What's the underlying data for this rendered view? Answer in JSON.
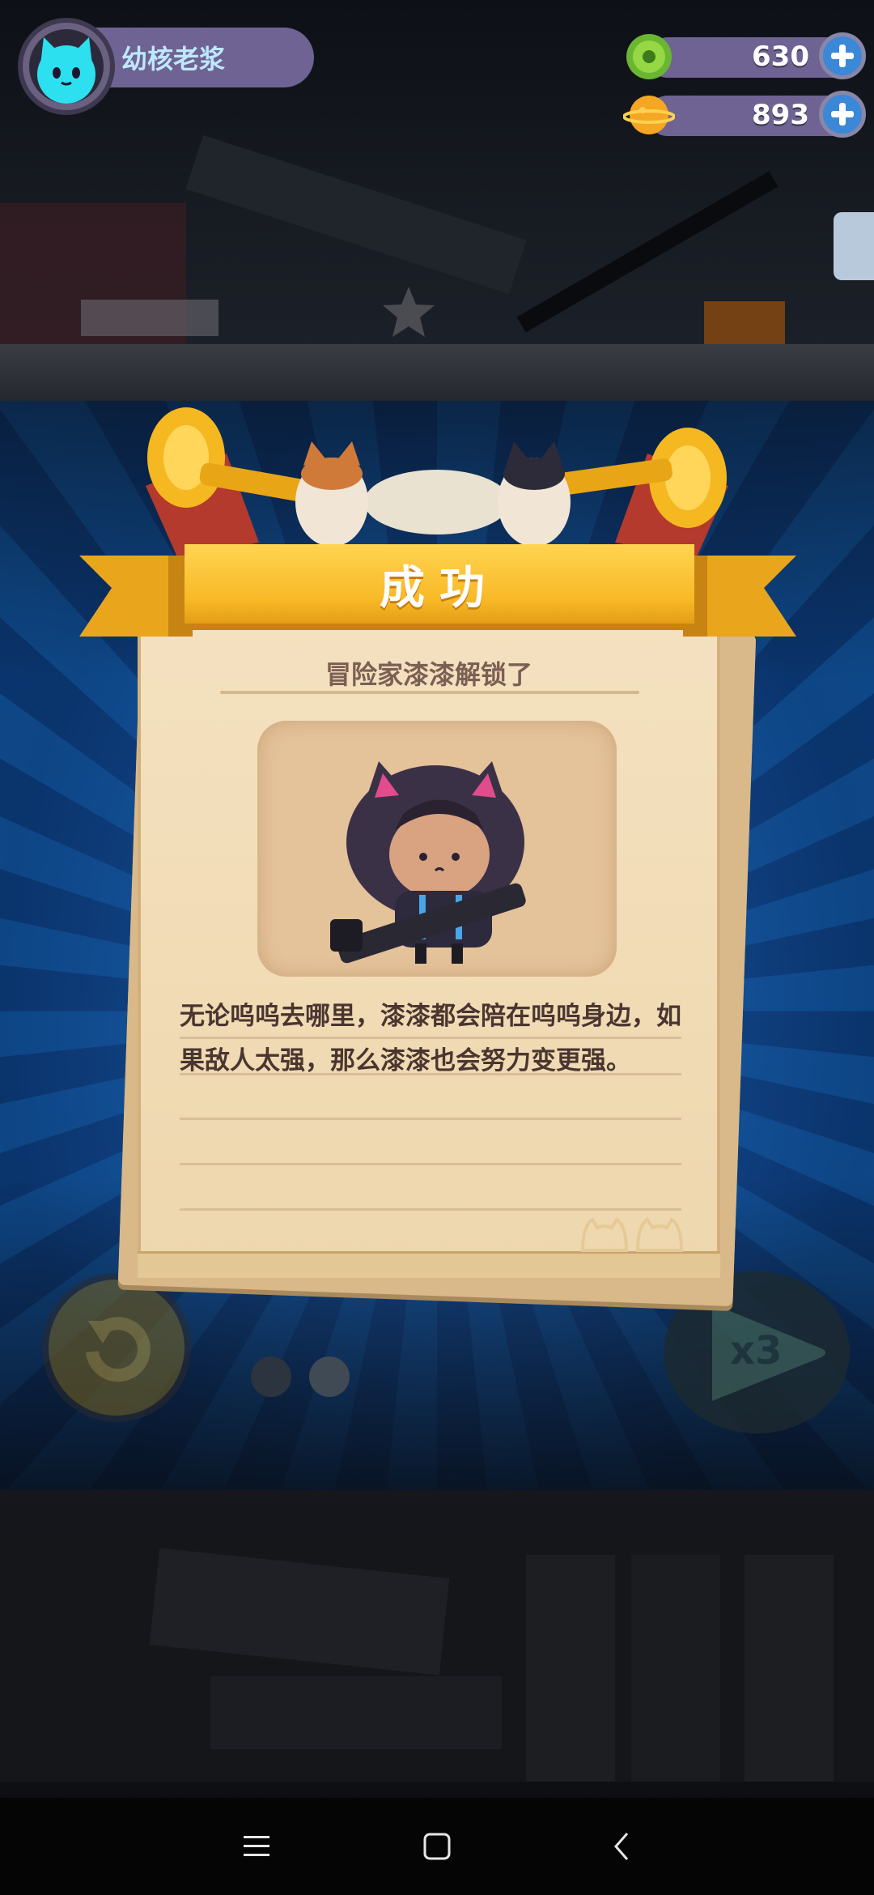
{
  "hud": {
    "player_name": "幼核老浆",
    "currencies": [
      {
        "name": "donut",
        "value": "630",
        "icon": "green-donut-icon"
      },
      {
        "name": "planet",
        "value": "893",
        "icon": "orange-planet-icon"
      }
    ]
  },
  "card": {
    "title": "成功",
    "subtitle": "冒险家漆漆解锁了",
    "description": "无论呜呜去哪里，漆漆都会陪在呜呜身边，如果敌人太强，那么漆漆也会努力变更强。"
  },
  "speed_button": {
    "label": "x3"
  },
  "colors": {
    "banner": "#f8b927",
    "paper": "#f2ddb6",
    "hud_plate": "#6e6392",
    "plus": "#3b88d8"
  }
}
